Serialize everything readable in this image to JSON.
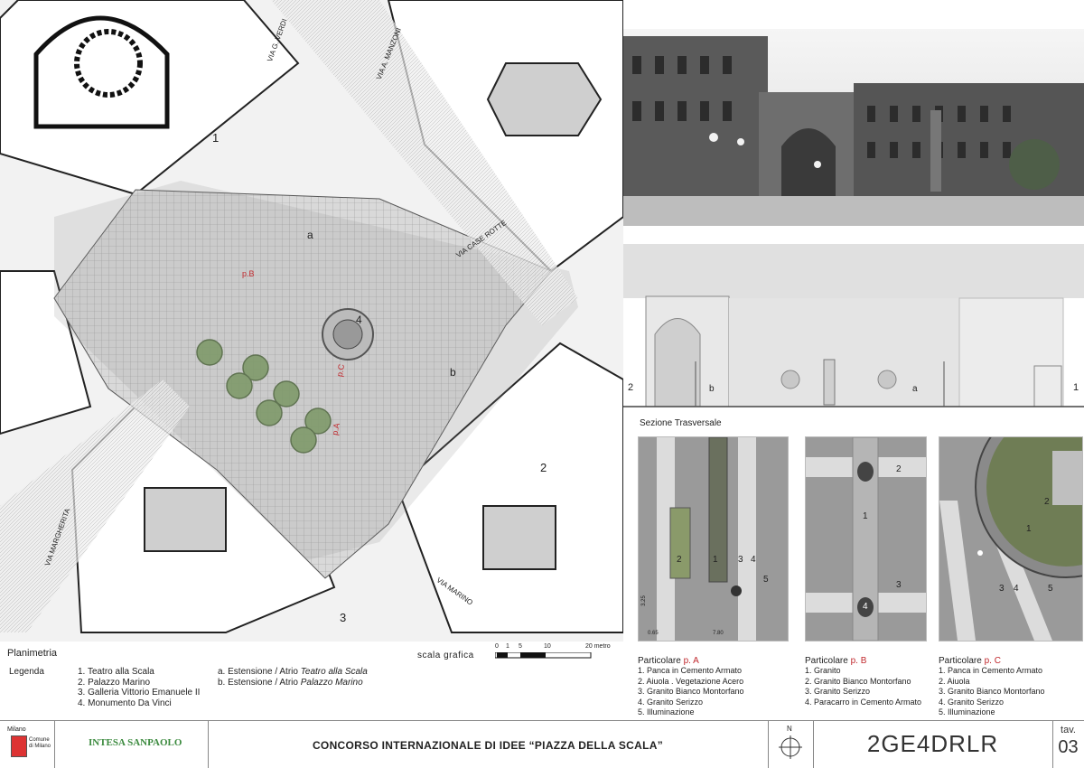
{
  "plan": {
    "street_labels": [
      "VIA G. VERDI",
      "VIA A. MANZONI",
      "VIA CASE ROTTE",
      "VIA MARGHERITA",
      "VIA MARINO"
    ],
    "building_numbers": [
      "1",
      "2",
      "3",
      "4"
    ],
    "area_letters": [
      "a",
      "b"
    ],
    "markers": [
      "p.B",
      "p.C",
      "p.A"
    ],
    "title": "Planimetria",
    "legend_label": "Legenda",
    "legend_numbers": [
      "1. Teatro alla Scala",
      "2. Palazzo Marino",
      "3. Galleria Vittorio Emanuele II",
      "4. Monumento Da Vinci"
    ],
    "legend_letters": [
      {
        "prefix": "a. Estensione / Atrio ",
        "italic": "Teatro alla Scala"
      },
      {
        "prefix": "b. Estensione / Atrio ",
        "italic": "Palazzo Marino"
      }
    ],
    "scale_label": "scala grafica",
    "scale_ticks": [
      "0",
      "1",
      "5",
      "10",
      "20 metro"
    ]
  },
  "section": {
    "label": "Sezione Trasversale",
    "side_left": "2",
    "side_right": "1",
    "letter_a": "a",
    "letter_b": "b"
  },
  "details": [
    {
      "title": "Particolare ",
      "tag": "p. A",
      "items": [
        "1.  Panca in Cemento Armato",
        "2.  Aiuola . Vegetazione Acero",
        "3.  Granito Bianco Montorfano",
        "4.  Granito Serizzo",
        "5.  Illuminazione"
      ],
      "dims": [
        "3.25",
        "0.65",
        "7.80"
      ],
      "nums": [
        "1",
        "2",
        "3",
        "4",
        "5"
      ]
    },
    {
      "title": "Particolare ",
      "tag": "p. B",
      "items": [
        "1.  Granito",
        "2.  Granito Bianco Montorfano",
        "3.  Granito Serizzo",
        "4.  Paracarro in Cemento Armato"
      ],
      "nums": [
        "1",
        "2",
        "3",
        "4"
      ]
    },
    {
      "title": "Particolare ",
      "tag": "p. C",
      "items": [
        "1.  Panca in Cemento Armato",
        "2.  Aiuola",
        "3.  Granito Bianco Montorfano",
        "4.  Granito Serizzo",
        "5.  Illuminazione"
      ],
      "nums": [
        "1",
        "2",
        "3",
        "4",
        "5"
      ]
    }
  ],
  "footer": {
    "logo_milano_top": "Milano",
    "logo_milano_side": "Comune di Milano",
    "logo_bank": "INTESA SANPAOLO",
    "title": "CONCORSO INTERNAZIONALE DI IDEE “PIAZZA  DELLA SCALA”",
    "north": "N",
    "code": "2GE4DRLR",
    "tav_label": "tav.",
    "tav_number": "03"
  },
  "colors": {
    "accent_red": "#c0282d",
    "bank_green": "#3b8a3e",
    "bank_orange": "#e07a1f"
  }
}
